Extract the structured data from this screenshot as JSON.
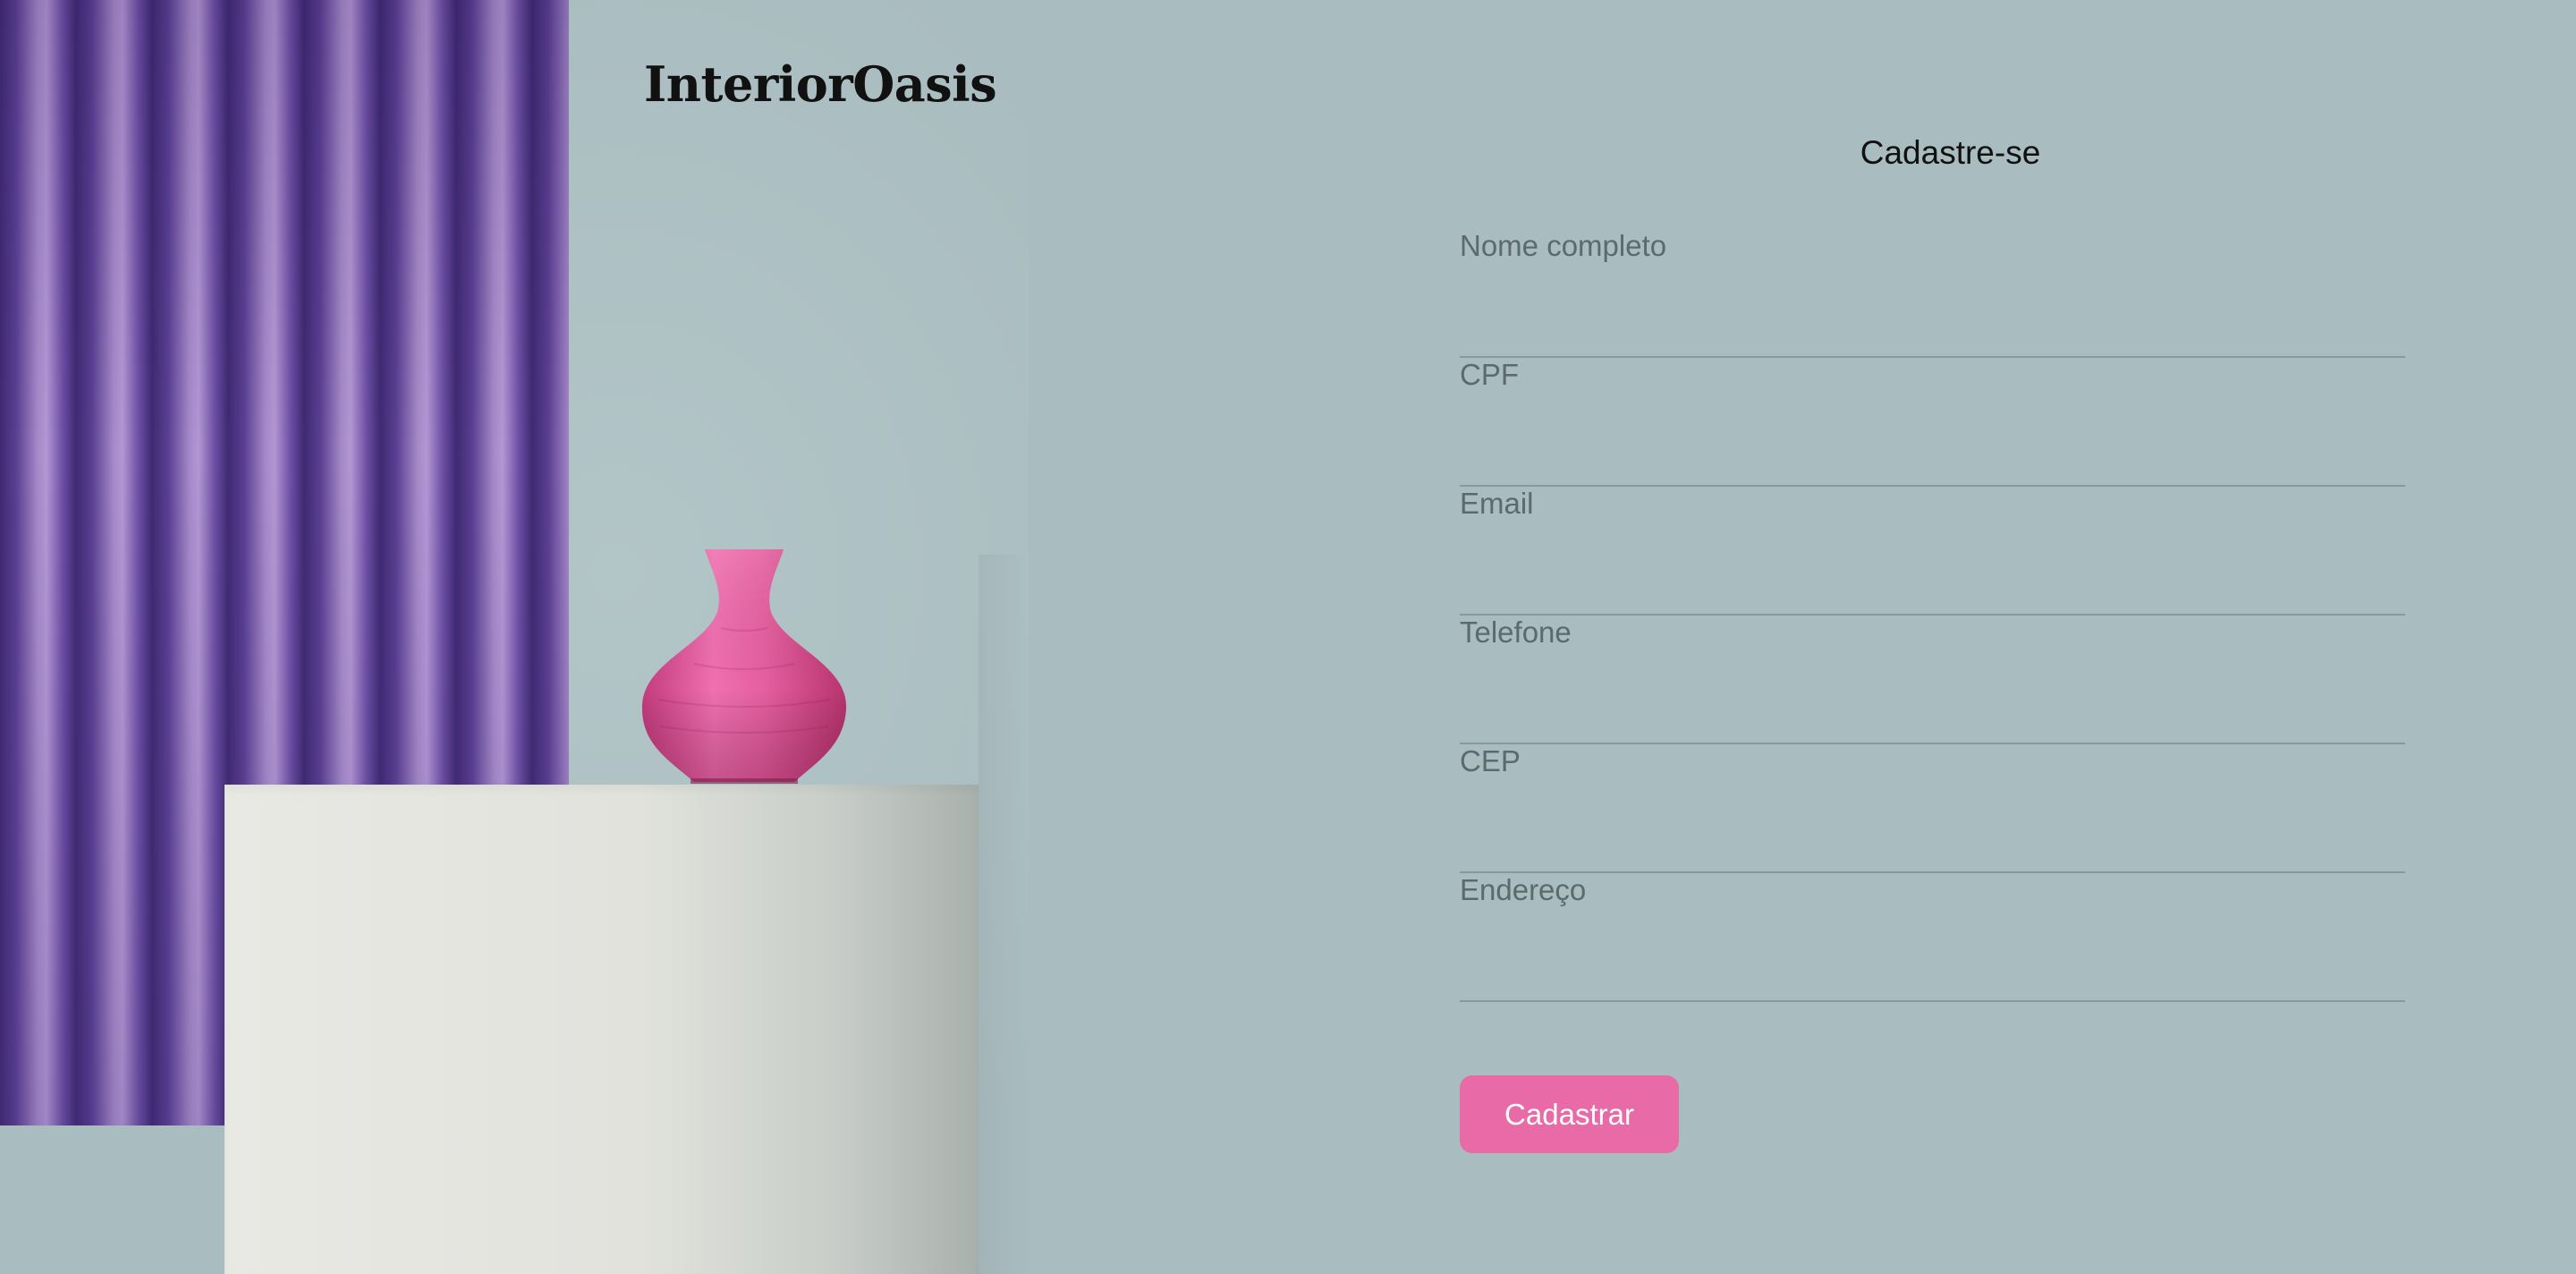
{
  "brand": {
    "logo_text": "InteriorOasis"
  },
  "form": {
    "title": "Cadastre-se",
    "fields": [
      {
        "label": "Nome completo",
        "value": ""
      },
      {
        "label": "CPF",
        "value": ""
      },
      {
        "label": "Email",
        "value": ""
      },
      {
        "label": "Telefone",
        "value": ""
      },
      {
        "label": "CEP",
        "value": ""
      },
      {
        "label": "Endereço",
        "value": ""
      }
    ],
    "submit_label": "Cadastrar"
  },
  "colors": {
    "background": "#a9bcbf",
    "accent_button": "#e86aa6",
    "curtain": "#5a3f92",
    "vase": "#e55fa0",
    "pedestal": "#e4e5df"
  },
  "hero": {
    "image_elements": [
      "curtain",
      "pedestal",
      "vase"
    ]
  }
}
